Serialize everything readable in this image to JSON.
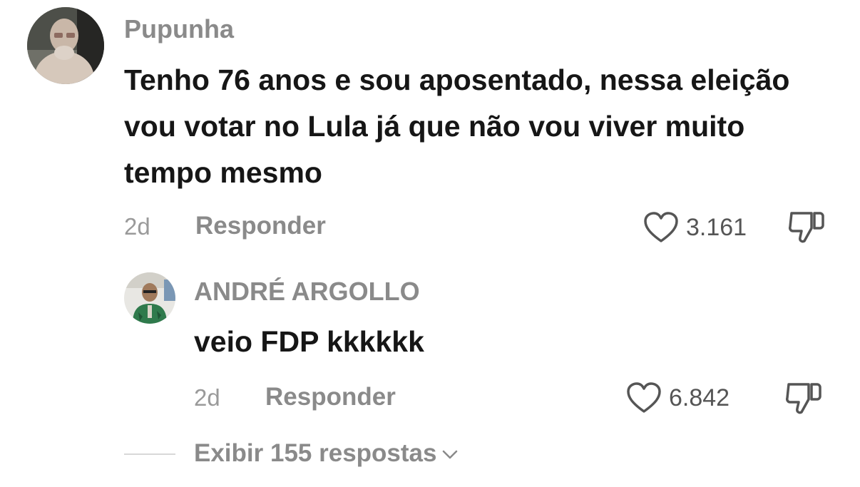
{
  "comments": [
    {
      "username": "Pupunha",
      "text": "Tenho 76 anos e sou aposentado, nessa eleição vou votar no Lula já que não vou viver muito tempo mesmo",
      "time": "2d",
      "reply_label": "Responder",
      "likes": "3.161"
    },
    {
      "username": "ANDRÉ ARGOLLO",
      "text": "veio FDP kkkkkk",
      "time": "2d",
      "reply_label": "Responder",
      "likes": "6.842"
    }
  ],
  "view_replies": "Exibir 155 respostas",
  "icons": {
    "like": "heart-icon",
    "dislike": "thumbs-down-icon",
    "expand": "chevron-down-icon"
  },
  "colors": {
    "text": "#161616",
    "muted": "#8a8a8a",
    "background": "#ffffff"
  }
}
